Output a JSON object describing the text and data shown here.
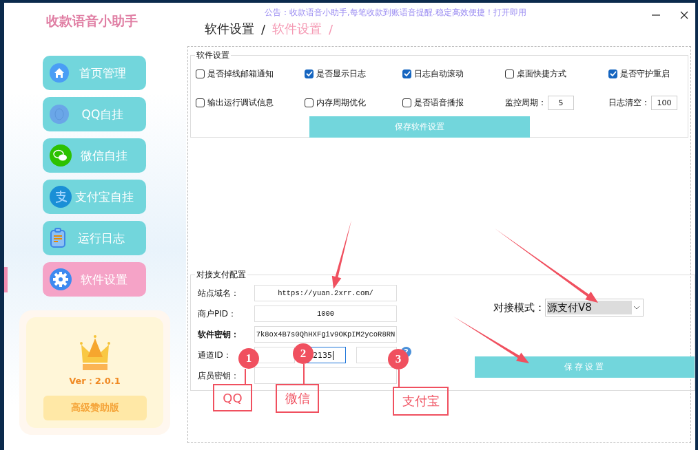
{
  "app": {
    "title": "收款语音小助手",
    "notice": "公告：收款语音小助手,每笔收款到账语音提醒.稳定高效便捷！打开即用"
  },
  "breadcrumb": [
    {
      "label": "软件设置",
      "separator": "/",
      "current": false
    },
    {
      "label": "软件设置",
      "separator": "/",
      "current": true
    }
  ],
  "sidebar": {
    "items": [
      {
        "label": "首页管理",
        "kind": "home",
        "selected": false
      },
      {
        "label": "QQ自挂",
        "kind": "qq",
        "selected": false
      },
      {
        "label": "微信自挂",
        "kind": "wechat",
        "selected": false
      },
      {
        "label": "支付宝自挂",
        "kind": "alipay",
        "selected": false
      },
      {
        "label": "运行日志",
        "kind": "log",
        "selected": false
      },
      {
        "label": "软件设置",
        "kind": "gear",
        "selected": true
      }
    ]
  },
  "version_card": {
    "version": "Ver：2.0.1",
    "button": "高级赞助版"
  },
  "software_settings": {
    "title": "软件设置",
    "options": [
      {
        "kind": "checkbox",
        "label": "是否掉线邮箱通知",
        "checked": false
      },
      {
        "kind": "checkbox",
        "label": "是否显示日志",
        "checked": true
      },
      {
        "kind": "checkbox",
        "label": "日志自动滚动",
        "checked": true
      },
      {
        "kind": "checkbox",
        "label": "桌面快捷方式",
        "checked": false
      },
      {
        "kind": "checkbox",
        "label": "是否守护重启",
        "checked": true
      },
      {
        "kind": "checkbox",
        "label": "输出运行调试信息",
        "checked": false
      },
      {
        "kind": "checkbox",
        "label": "内存周期优化",
        "checked": false
      },
      {
        "kind": "checkbox",
        "label": "是否语音播报",
        "checked": false
      },
      {
        "kind": "number",
        "label": "监控周期：",
        "value": "5"
      },
      {
        "kind": "number",
        "label": "日志清空：",
        "value": "100"
      }
    ],
    "save_button": "保存软件设置"
  },
  "payment_config": {
    "title": "对接支付配置",
    "fields": [
      {
        "label": "站点域名：",
        "bold": false,
        "inputs": [
          {
            "value": "https://yuan.2xrr.com/",
            "focused": false
          }
        ]
      },
      {
        "label": "商户PID：",
        "bold": false,
        "inputs": [
          {
            "value": "1000",
            "focused": false
          }
        ]
      },
      {
        "label": "软件密钥：",
        "bold": true,
        "inputs": [
          {
            "value": "7k8ox4B7s0QhHXFgiv9OKpIM2ycoR8RN",
            "focused": false
          }
        ]
      },
      {
        "label": "通道ID：",
        "bold": false,
        "help": "?",
        "inputs": [
          {
            "focused": false
          },
          {
            "value": "2135",
            "focused": true
          },
          {
            "focused": false
          }
        ]
      },
      {
        "label": "店员密钥：",
        "bold": false,
        "inputs": [
          {
            "focused": false
          }
        ]
      }
    ],
    "mode_label": "对接模式：",
    "mode_value": "源支付V8",
    "save_button": "保存设置"
  },
  "annotations": [
    {
      "number": "1",
      "label": "QQ"
    },
    {
      "number": "2",
      "label": "微信"
    },
    {
      "number": "3",
      "label": "支付宝"
    }
  ]
}
